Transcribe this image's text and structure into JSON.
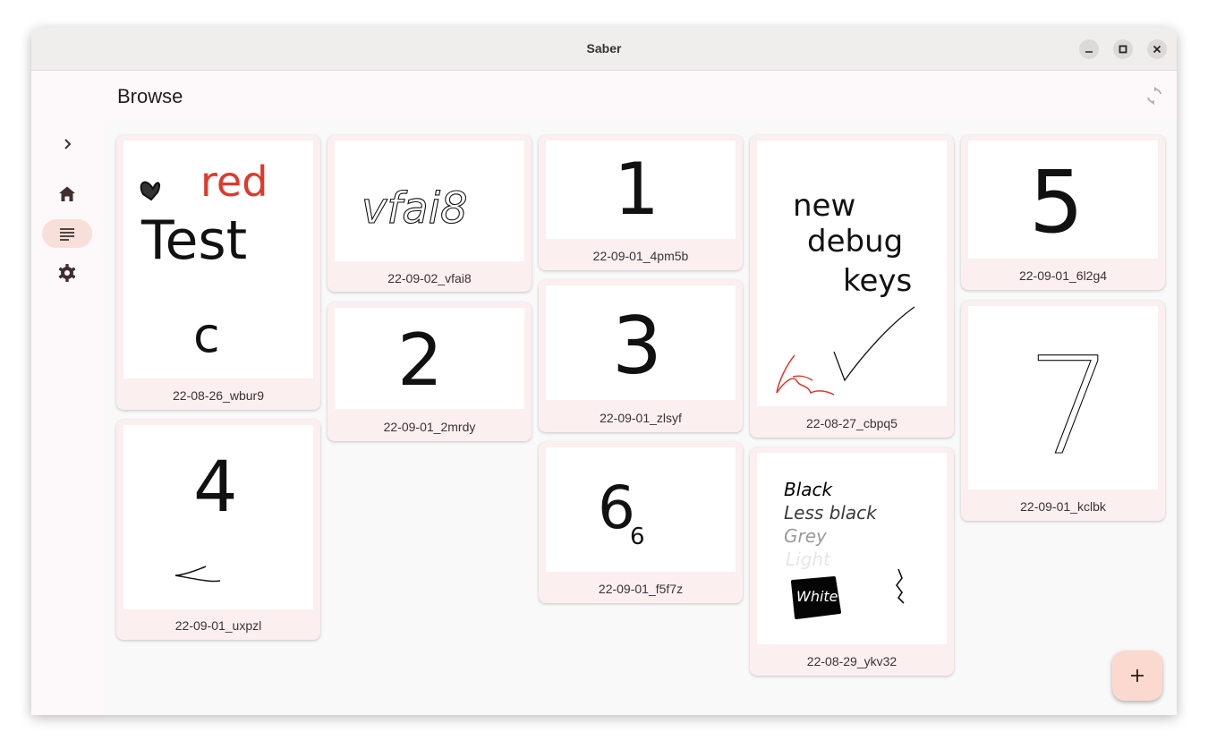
{
  "window": {
    "title": "Saber"
  },
  "header": {
    "title": "Browse"
  },
  "rail": {
    "items": [
      "expand-icon",
      "home-icon",
      "browse-icon",
      "settings-icon"
    ],
    "active": "browse"
  },
  "notes": [
    {
      "name": "22-08-26_wbur9",
      "preview_text": [
        "red",
        "Test",
        "c"
      ]
    },
    {
      "name": "22-09-01_uxpzl",
      "preview_text": [
        "4"
      ]
    },
    {
      "name": "22-09-02_vfai8",
      "preview_text": [
        "vfai8"
      ]
    },
    {
      "name": "22-09-01_2mrdy",
      "preview_text": [
        "2"
      ]
    },
    {
      "name": "22-09-01_4pm5b",
      "preview_text": [
        "1"
      ]
    },
    {
      "name": "22-09-01_zlsyf",
      "preview_text": [
        "3"
      ]
    },
    {
      "name": "22-09-01_f5f7z",
      "preview_text": [
        "6",
        "6"
      ]
    },
    {
      "name": "22-08-27_cbpq5",
      "preview_text": [
        "new",
        "debug",
        "keys"
      ]
    },
    {
      "name": "22-08-29_ykv32",
      "preview_text": [
        "Black",
        "Less black",
        "Grey",
        "Light",
        "White"
      ]
    },
    {
      "name": "22-09-01_6l2g4",
      "preview_text": [
        "5"
      ]
    },
    {
      "name": "22-09-01_kclbk",
      "preview_text": [
        "7"
      ]
    }
  ],
  "colors": {
    "accent": "#f9dfd9",
    "card": "#fbeff0",
    "ink_red": "#e0392b",
    "fab": "#fcd9cf"
  }
}
